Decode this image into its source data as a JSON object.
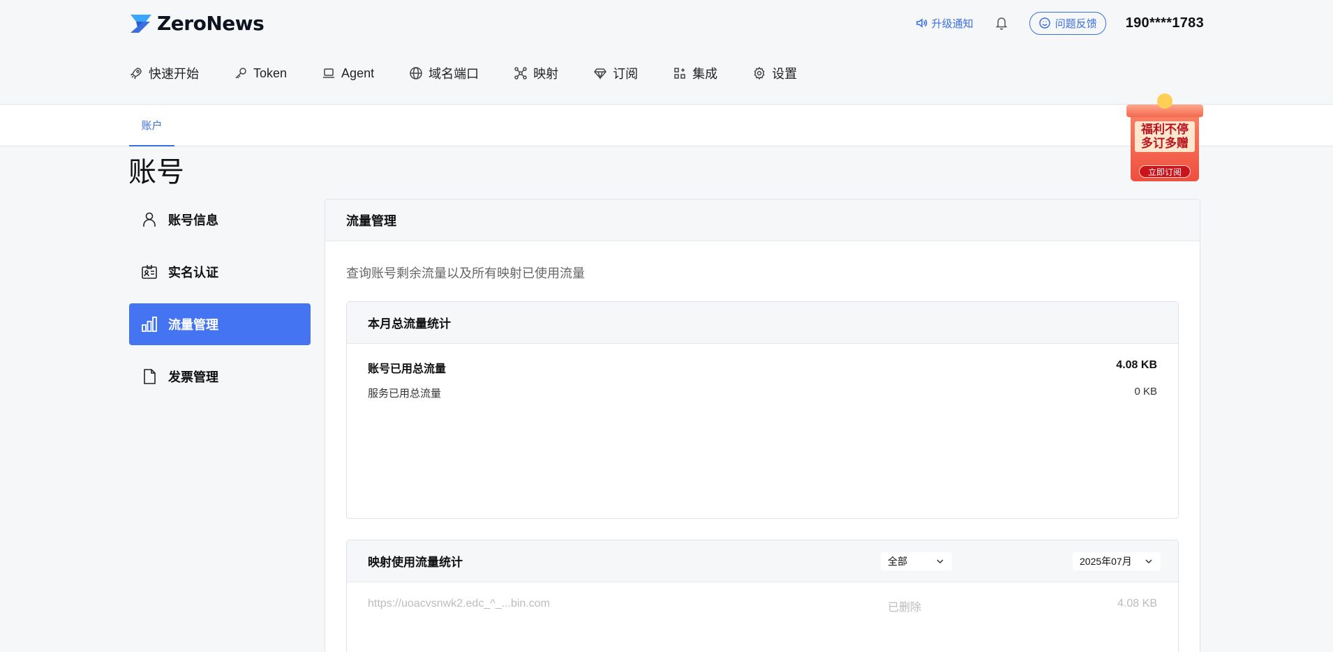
{
  "brand": {
    "name": "ZeroNews",
    "accent": "#4474f2",
    "logo_colors": [
      "#3aa7ff",
      "#3a6fe0"
    ]
  },
  "header": {
    "upgrade_label": "升级通知",
    "feedback_label": "问题反馈",
    "phone": "190****1783"
  },
  "nav": {
    "items": [
      {
        "label": "快速开始",
        "icon": "rocket-icon"
      },
      {
        "label": "Token",
        "icon": "key-icon"
      },
      {
        "label": "Agent",
        "icon": "laptop-icon"
      },
      {
        "label": "域名端口",
        "icon": "globe-icon"
      },
      {
        "label": "映射",
        "icon": "network-icon"
      },
      {
        "label": "订阅",
        "icon": "diamond-icon"
      },
      {
        "label": "集成",
        "icon": "apps-icon"
      },
      {
        "label": "设置",
        "icon": "gear-icon"
      }
    ]
  },
  "subtab": {
    "label": "账户"
  },
  "page": {
    "title": "账号"
  },
  "gift": {
    "line1": "福利不停",
    "line2": "多订多赠",
    "button": "立即订阅"
  },
  "sidebar": {
    "items": [
      {
        "label": "账号信息",
        "icon": "user-icon",
        "active": false
      },
      {
        "label": "实名认证",
        "icon": "id-card-icon",
        "active": false
      },
      {
        "label": "流量管理",
        "icon": "bar-chart-icon",
        "active": true
      },
      {
        "label": "发票管理",
        "icon": "document-icon",
        "active": false
      }
    ]
  },
  "main": {
    "title": "流量管理",
    "description": "查询账号剩余流量以及所有映射已使用流量",
    "monthly": {
      "title": "本月总流量统计",
      "account_label": "账号已用总流量",
      "account_value": "4.08 KB",
      "service_label": "服务已用总流量",
      "service_value": "0 KB"
    },
    "mapping": {
      "title": "映射使用流量统计",
      "filter_value": "全部",
      "month_value": "2025年07月",
      "rows": [
        {
          "url": "https://uoacvsnwk2.edc_^_...bin.com",
          "status": "已删除",
          "value": "4.08 KB"
        }
      ]
    }
  }
}
